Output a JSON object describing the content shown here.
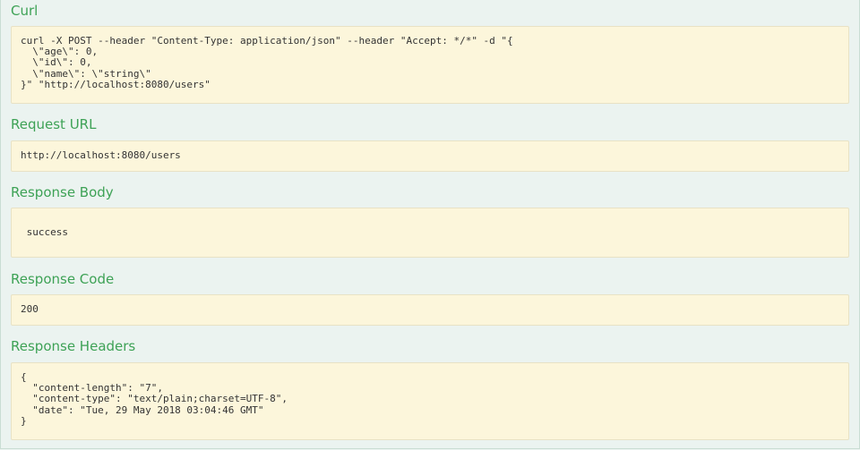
{
  "sections": {
    "curl": {
      "title": "Curl",
      "content": "curl -X POST --header \"Content-Type: application/json\" --header \"Accept: */*\" -d \"{\n  \\\"age\\\": 0,\n  \\\"id\\\": 0,\n  \\\"name\\\": \\\"string\\\"\n}\" \"http://localhost:8080/users\""
    },
    "request_url": {
      "title": "Request URL",
      "content": "http://localhost:8080/users"
    },
    "response_body": {
      "title": "Response Body",
      "content": " success"
    },
    "response_code": {
      "title": "Response Code",
      "content": "200"
    },
    "response_headers": {
      "title": "Response Headers",
      "content": "{\n  \"content-length\": \"7\",\n  \"content-type\": \"text/plain;charset=UTF-8\",\n  \"date\": \"Tue, 29 May 2018 03:04:46 GMT\"\n}"
    }
  }
}
